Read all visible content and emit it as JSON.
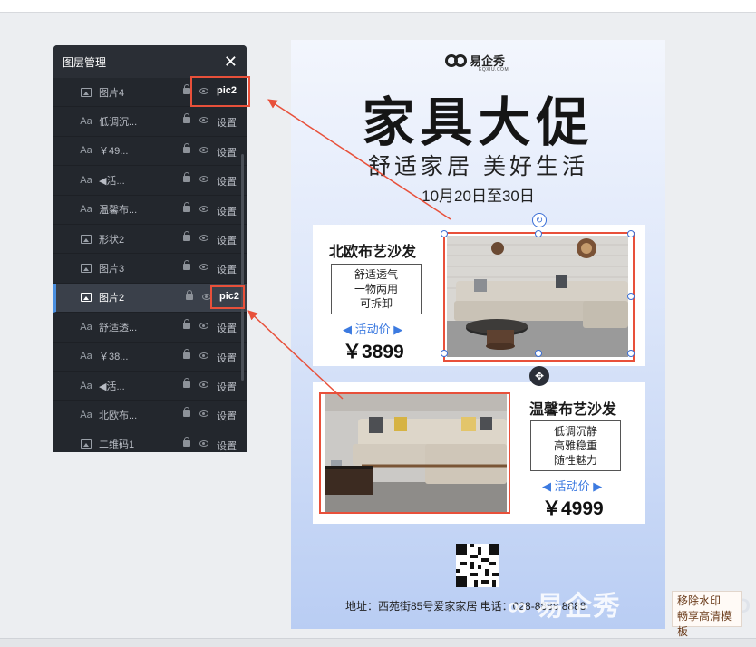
{
  "layer_panel": {
    "title": "图层管理",
    "close_label": "✕",
    "setting_label": "设置",
    "rows": [
      {
        "type": "image",
        "name": "图片4",
        "tag": "pic2"
      },
      {
        "type": "text",
        "name": "低调沉..."
      },
      {
        "type": "text",
        "name": "￥49..."
      },
      {
        "type": "text",
        "name": "◀活..."
      },
      {
        "type": "text",
        "name": "温馨布..."
      },
      {
        "type": "image",
        "name": "形状2"
      },
      {
        "type": "image",
        "name": "图片3"
      },
      {
        "type": "image",
        "name": "图片2",
        "tag": "pic2",
        "active": true
      },
      {
        "type": "text",
        "name": "舒适透..."
      },
      {
        "type": "text",
        "name": "￥38..."
      },
      {
        "type": "text",
        "name": "◀活..."
      },
      {
        "type": "text",
        "name": "北欧布..."
      },
      {
        "type": "image",
        "name": "二维码1"
      }
    ],
    "text_type_icon": "Aa"
  },
  "poster": {
    "logo_text": "易企秀",
    "logo_sub": "EQXIU.COM",
    "title": "家具大促",
    "subtitle": "舒适家居  美好生活",
    "date": "10月20日至30日",
    "product1": {
      "name": "北欧布艺沙发",
      "features": [
        "舒适透气",
        "一物两用",
        "可拆卸"
      ],
      "promo": "◀ 活动价 ▶",
      "price": "￥3899"
    },
    "product2": {
      "name": "温馨布艺沙发",
      "features": [
        "低调沉静",
        "高雅稳重",
        "随性魅力"
      ],
      "promo": "◀ 活动价 ▶",
      "price": "￥4999"
    },
    "address": "地址：西苑街85号爱家家居  电话：028-8888 8888",
    "watermark": "易企秀"
  },
  "watermark_button": {
    "line1": "移除水印",
    "line2": "畅享高清模板"
  },
  "colors": {
    "accent": "#e8503a",
    "selection": "#3b6fd6",
    "panel_bg": "#2a2e35"
  }
}
